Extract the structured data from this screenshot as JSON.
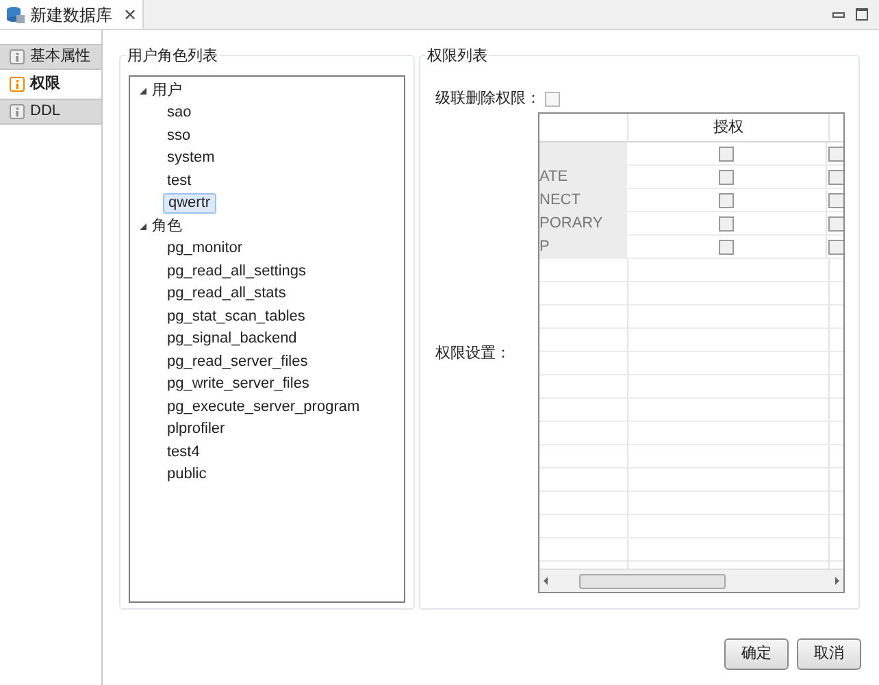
{
  "editor_tab": {
    "title": "新建数据库",
    "close": "✕"
  },
  "nav": [
    {
      "label": "基本属性",
      "selected": false
    },
    {
      "label": "权限",
      "selected": true
    },
    {
      "label": "DDL",
      "selected": false
    }
  ],
  "user_role_list": {
    "title": "用户角色列表",
    "tree": [
      {
        "label": "用户",
        "expanded": true,
        "children": [
          {
            "label": "sao",
            "selected": false
          },
          {
            "label": "sso",
            "selected": false
          },
          {
            "label": "system",
            "selected": false
          },
          {
            "label": "test",
            "selected": false
          },
          {
            "label": "qwertr",
            "selected": true
          }
        ]
      },
      {
        "label": "角色",
        "expanded": true,
        "children": [
          {
            "label": "pg_monitor",
            "selected": false
          },
          {
            "label": "pg_read_all_settings",
            "selected": false
          },
          {
            "label": "pg_read_all_stats",
            "selected": false
          },
          {
            "label": "pg_stat_scan_tables",
            "selected": false
          },
          {
            "label": "pg_signal_backend",
            "selected": false
          },
          {
            "label": "pg_read_server_files",
            "selected": false
          },
          {
            "label": "pg_write_server_files",
            "selected": false
          },
          {
            "label": "pg_execute_server_program",
            "selected": false
          },
          {
            "label": "plprofiler",
            "selected": false
          },
          {
            "label": "test4",
            "selected": false
          },
          {
            "label": "public",
            "selected": false
          }
        ]
      }
    ]
  },
  "permission_list": {
    "title": "权限列表",
    "cascade_label": "级联删除权限：",
    "cascade_checked": false,
    "settings_label": "权限设置：",
    "table": {
      "columns": [
        "授权"
      ],
      "rows": [
        {
          "grant": false,
          "column_3": false
        },
        {
          "privilege": "ATE",
          "grant": false,
          "column_3": false
        },
        {
          "privilege": "NECT",
          "grant": false,
          "column_3": false
        },
        {
          "privilege": "PORARY",
          "grant": false,
          "column_3": false
        },
        {
          "privilege": "P",
          "grant": false,
          "column_3": false
        }
      ]
    }
  },
  "buttons": [
    "确定",
    "取消"
  ]
}
